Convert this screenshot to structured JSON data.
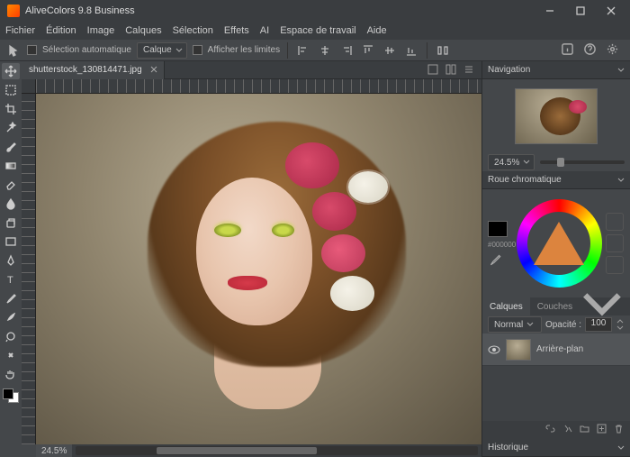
{
  "app": {
    "title": "AliveColors 9.8 Business"
  },
  "menu": [
    "Fichier",
    "Édition",
    "Image",
    "Calques",
    "Sélection",
    "Effets",
    "AI",
    "Espace de travail",
    "Aide"
  ],
  "options": {
    "auto_select": "Sélection automatique",
    "layer_dd": "Calque",
    "show_bounds": "Afficher les limites"
  },
  "document": {
    "filename": "shutterstock_130814471.jpg",
    "zoom": "24.5%"
  },
  "panels": {
    "navigation": {
      "title": "Navigation",
      "zoom": "24.5%"
    },
    "wheel": {
      "title": "Roue chromatique",
      "hex": "#000000"
    },
    "layers": {
      "tab_layers": "Calques",
      "tab_channels": "Couches",
      "blend": "Normal",
      "opacity_label": "Opacité :",
      "opacity_value": "100",
      "layer0": "Arrière-plan"
    },
    "history": {
      "title": "Historique"
    }
  }
}
